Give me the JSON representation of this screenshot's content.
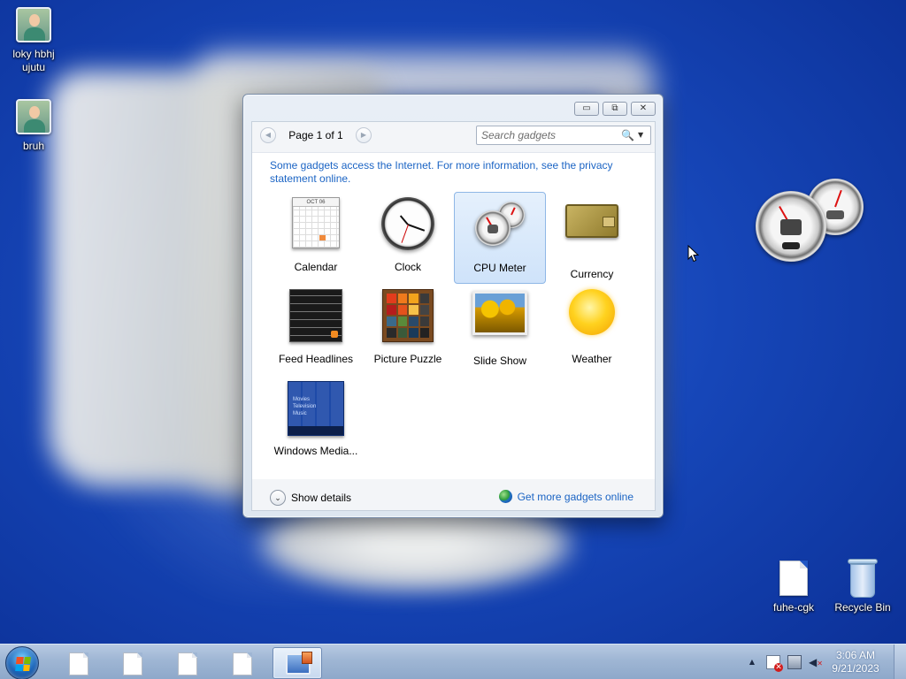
{
  "desktop": {
    "icons": [
      {
        "label": "loky hbhj\nujutu"
      },
      {
        "label": "bruh"
      },
      {
        "label": "fuhe-cgk"
      },
      {
        "label": "Recycle Bin"
      }
    ]
  },
  "gadget_window": {
    "controls": {
      "minimize": "▭",
      "restore": "⧉",
      "close": "✕"
    },
    "pager": {
      "label": "Page 1 of 1",
      "prev": "◀",
      "next": "▶"
    },
    "search": {
      "placeholder": "Search gadgets",
      "icon": "🔍",
      "dropdown": "▼"
    },
    "info_text": "Some gadgets access the Internet.  For more information, see the privacy statement online.",
    "gadgets": [
      {
        "label": "Calendar",
        "month": "OCT 06"
      },
      {
        "label": "Clock"
      },
      {
        "label": "CPU Meter",
        "selected": true
      },
      {
        "label": "Currency"
      },
      {
        "label": "Feed Headlines"
      },
      {
        "label": "Picture Puzzle"
      },
      {
        "label": "Slide Show"
      },
      {
        "label": "Weather"
      },
      {
        "label": "Windows Media...",
        "lines": [
          "Movies",
          "Television",
          "Music"
        ]
      }
    ],
    "footer": {
      "show_details": "Show details",
      "show_details_icon": "⌄",
      "more_online": "Get more gadgets online"
    }
  },
  "taskbar": {
    "clock_time": "3:06 AM",
    "clock_date": "9/21/2023",
    "tray_up_arrow": "▲"
  },
  "colors": {
    "link": "#1b64c4",
    "desktop_blue": "#1646b8",
    "selection": "#cfe3fa"
  }
}
